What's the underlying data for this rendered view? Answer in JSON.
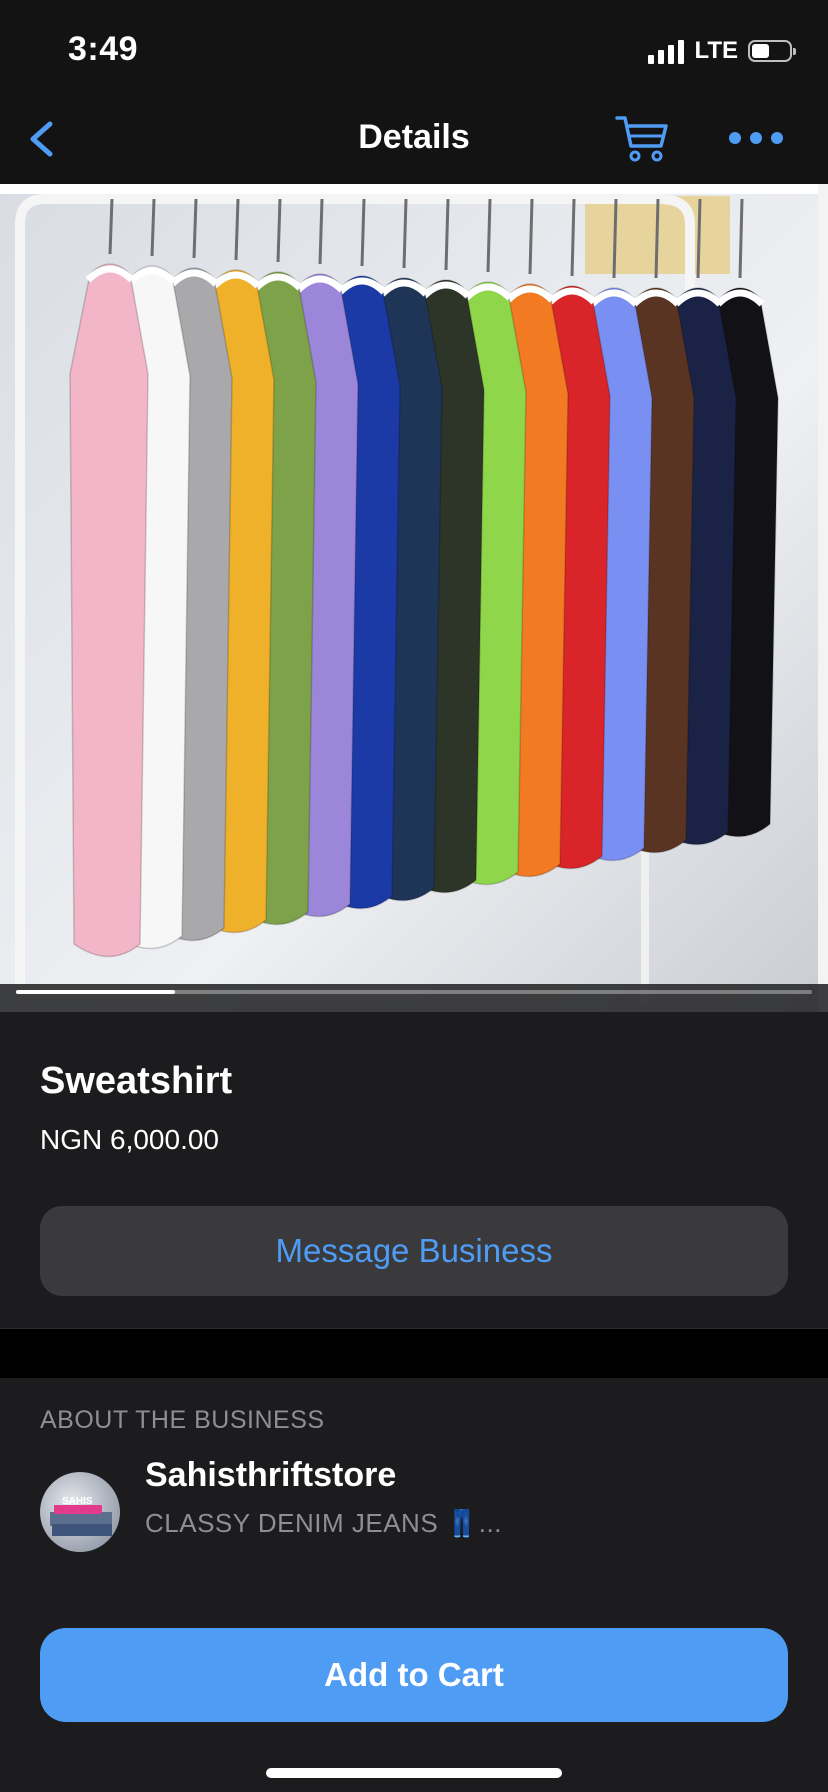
{
  "status_bar": {
    "time": "3:49",
    "network": "LTE",
    "battery_level": 0.48
  },
  "nav": {
    "title": "Details",
    "back_icon": "chevron-left-icon",
    "cart_icon": "cart-icon",
    "more_icon": "ellipsis-icon"
  },
  "product": {
    "image_description_colors": [
      "#f2b6c8",
      "#f7f7f7",
      "#a9a9ab",
      "#f0b12a",
      "#7ea24a",
      "#9b86d9",
      "#1b3aa6",
      "#1f3558",
      "#2c3527",
      "#8fd64a",
      "#f27a22",
      "#d9252a",
      "#7a8ff2",
      "#5a3423",
      "#1a2346",
      "#121216"
    ],
    "image_index": 1,
    "image_count": 5,
    "name": "Sweatshirt",
    "price": "NGN 6,000.00",
    "message_button": "Message Business"
  },
  "about": {
    "heading": "ABOUT THE BUSINESS",
    "business_name": "Sahisthriftstore",
    "tagline": "CLASSY DENIM JEANS 👖...",
    "avatar_logo_text": "SAHIS"
  },
  "actions": {
    "add_to_cart": "Add to Cart"
  },
  "colors": {
    "accent": "#4f9cf5",
    "background": "#1c1c1e",
    "secondary_button": "#3a3a3c",
    "muted_text": "#8e8e93"
  }
}
